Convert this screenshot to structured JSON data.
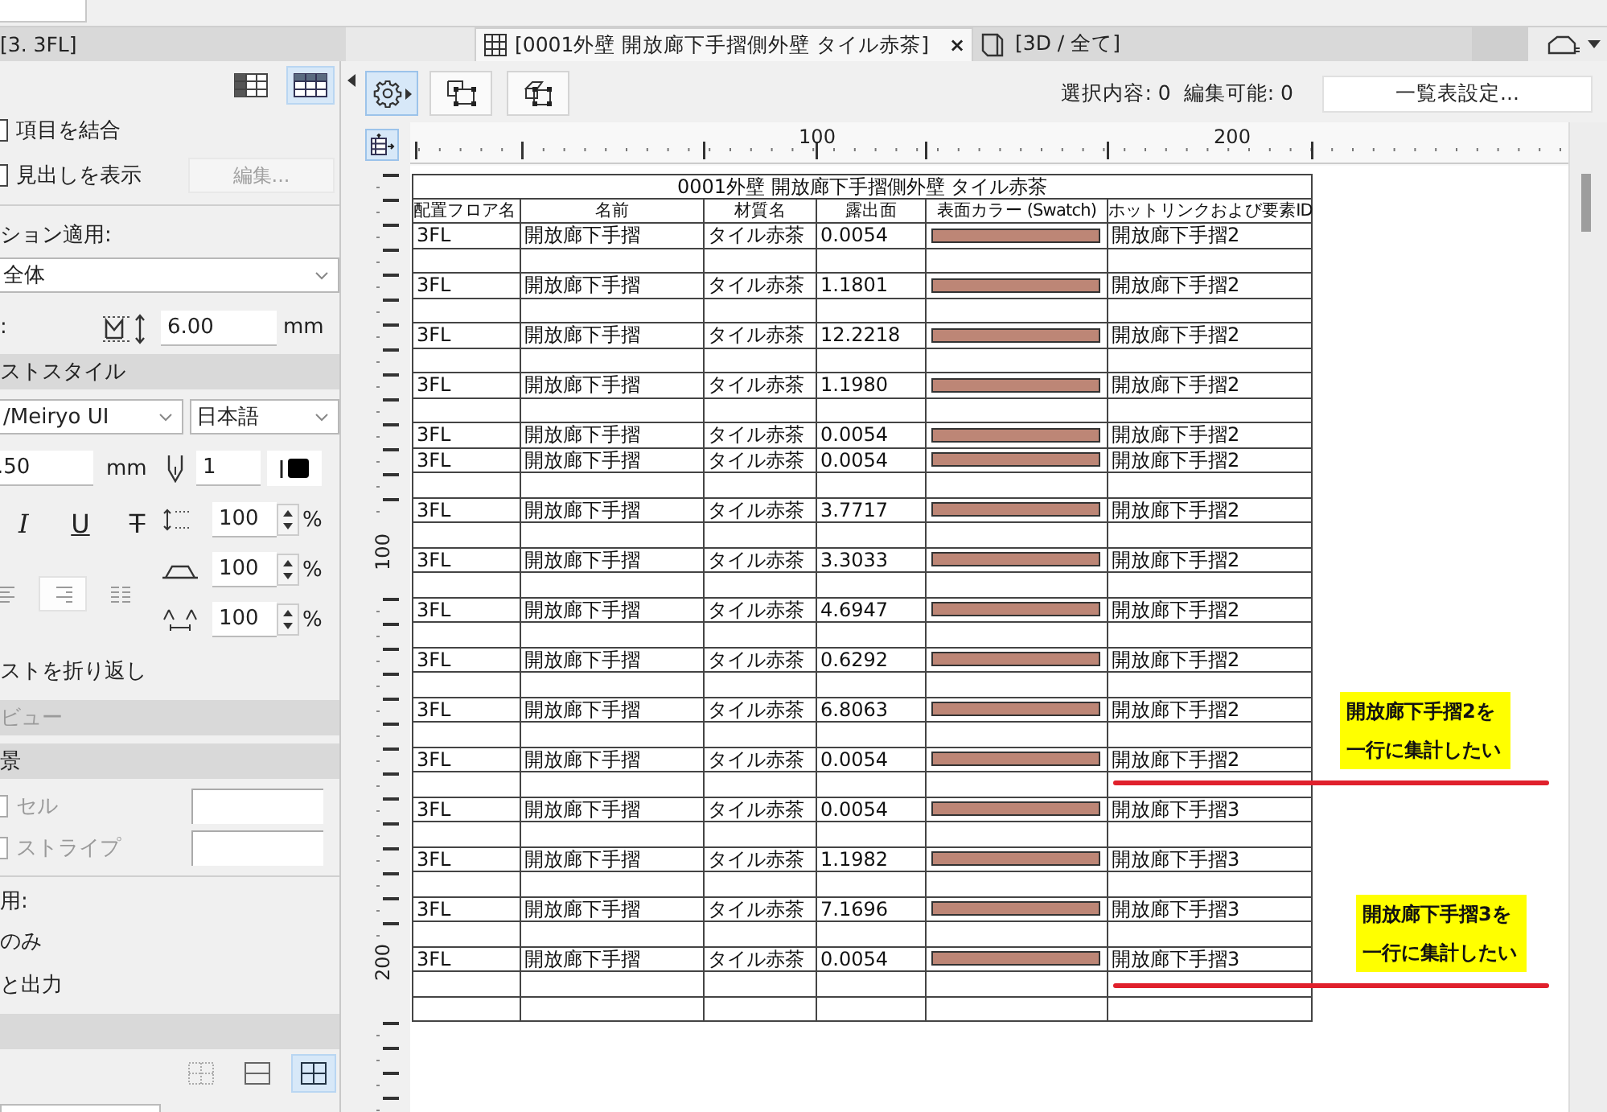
{
  "tabs": [
    {
      "label": "[3. 3FL]",
      "kind": "cut",
      "selected": false
    },
    {
      "label": "[0001外壁 開放廊下手摺側外壁  タイル赤茶]",
      "kind": "schedule",
      "selected": true,
      "close": "×"
    },
    {
      "label": "[3D / 全て]",
      "kind": "model",
      "selected": false
    }
  ],
  "side_panel": {
    "view_buttons": [
      {
        "selected": false
      },
      {
        "selected": true
      }
    ],
    "checks": [
      {
        "label": "項目を結合",
        "checked": false
      },
      {
        "label": "見出しを表示",
        "checked": false
      }
    ],
    "edit_button": {
      "label": "編集...",
      "disabled": true
    },
    "apply_label": "ション適用:",
    "apply_value": "全体",
    "height_label": ":",
    "height_value": "6.00",
    "height_unit": "mm",
    "text_style_header": "ストスタイル",
    "font": "/Meiryo UI",
    "language": "日本語",
    "size_value": ".50",
    "size_unit": "mm",
    "pen_value": "1",
    "style_buttons": [
      {
        "label": "I",
        "kind": "italic"
      },
      {
        "label": "U",
        "kind": "underline"
      },
      {
        "label": "T",
        "kind": "strike"
      }
    ],
    "align_buttons": [
      {
        "selected": false
      },
      {
        "selected": true
      },
      {
        "selected": false
      }
    ],
    "scales": [
      {
        "kind": "line",
        "value": "100",
        "unit": "%"
      },
      {
        "kind": "width",
        "value": "100",
        "unit": "%"
      },
      {
        "kind": "spacing",
        "value": "100",
        "unit": "%"
      }
    ],
    "wrap_label": "ストを折り返し",
    "preview_header": {
      "label": "ビュー",
      "disabled": true
    },
    "background_header": "景",
    "fills": [
      {
        "label": "セル",
        "checked": false,
        "disabled": true
      },
      {
        "label": "ストライプ",
        "checked": false,
        "disabled": true
      }
    ],
    "output_label": "用:",
    "output_options": [
      "のみ",
      "と出力"
    ],
    "grid_buttons": [
      {
        "selected": false
      },
      {
        "selected": false
      },
      {
        "selected": true
      }
    ]
  },
  "toolbar": {
    "status": [
      "選択内容: 0",
      "編集可能: 0"
    ],
    "settings_button": "一覧表設定..."
  },
  "rulers": {
    "horizontal": [
      "100",
      "200"
    ],
    "vertical": [
      "100",
      "200"
    ]
  },
  "schedule": {
    "title": "0001外壁 開放廊下手摺側外壁  タイル赤茶",
    "columns": [
      "配置フロア名",
      "名前",
      "材質名",
      "露出面",
      "表面カラー (Swatch)",
      "ホットリンクおよび要素ID"
    ],
    "rows": [
      {
        "kind": "data",
        "floor": "3FL",
        "name": "開放廊下手摺",
        "material": "タイル赤茶",
        "area": "0.0054",
        "color": "#bd8676",
        "hotlink": "開放廊下手摺2"
      },
      {
        "kind": "blank"
      },
      {
        "kind": "data",
        "floor": "3FL",
        "name": "開放廊下手摺",
        "material": "タイル赤茶",
        "area": "1.1801",
        "color": "#bd8676",
        "hotlink": "開放廊下手摺2"
      },
      {
        "kind": "blank"
      },
      {
        "kind": "data",
        "floor": "3FL",
        "name": "開放廊下手摺",
        "material": "タイル赤茶",
        "area": "12.2218",
        "color": "#bd8676",
        "hotlink": "開放廊下手摺2"
      },
      {
        "kind": "blank"
      },
      {
        "kind": "data",
        "floor": "3FL",
        "name": "開放廊下手摺",
        "material": "タイル赤茶",
        "area": "1.1980",
        "color": "#bd8676",
        "hotlink": "開放廊下手摺2"
      },
      {
        "kind": "blank"
      },
      {
        "kind": "data",
        "floor": "3FL",
        "name": "開放廊下手摺",
        "material": "タイル赤茶",
        "area": "0.0054",
        "color": "#bd8676",
        "hotlink": "開放廊下手摺2"
      },
      {
        "kind": "data",
        "floor": "3FL",
        "name": "開放廊下手摺",
        "material": "タイル赤茶",
        "area": "0.0054",
        "color": "#bd8676",
        "hotlink": "開放廊下手摺2"
      },
      {
        "kind": "blank"
      },
      {
        "kind": "data",
        "floor": "3FL",
        "name": "開放廊下手摺",
        "material": "タイル赤茶",
        "area": "3.7717",
        "color": "#bd8676",
        "hotlink": "開放廊下手摺2"
      },
      {
        "kind": "blank"
      },
      {
        "kind": "data",
        "floor": "3FL",
        "name": "開放廊下手摺",
        "material": "タイル赤茶",
        "area": "3.3033",
        "color": "#bd8676",
        "hotlink": "開放廊下手摺2"
      },
      {
        "kind": "blank"
      },
      {
        "kind": "data",
        "floor": "3FL",
        "name": "開放廊下手摺",
        "material": "タイル赤茶",
        "area": "4.6947",
        "color": "#bd8676",
        "hotlink": "開放廊下手摺2"
      },
      {
        "kind": "blank"
      },
      {
        "kind": "data",
        "floor": "3FL",
        "name": "開放廊下手摺",
        "material": "タイル赤茶",
        "area": "0.6292",
        "color": "#bd8676",
        "hotlink": "開放廊下手摺2"
      },
      {
        "kind": "blank"
      },
      {
        "kind": "data",
        "floor": "3FL",
        "name": "開放廊下手摺",
        "material": "タイル赤茶",
        "area": "6.8063",
        "color": "#bd8676",
        "hotlink": "開放廊下手摺2"
      },
      {
        "kind": "blank"
      },
      {
        "kind": "data",
        "floor": "3FL",
        "name": "開放廊下手摺",
        "material": "タイル赤茶",
        "area": "0.0054",
        "color": "#bd8676",
        "hotlink": "開放廊下手摺2"
      },
      {
        "kind": "blank"
      },
      {
        "kind": "data",
        "floor": "3FL",
        "name": "開放廊下手摺",
        "material": "タイル赤茶",
        "area": "0.0054",
        "color": "#bd8676",
        "hotlink": "開放廊下手摺3"
      },
      {
        "kind": "blank"
      },
      {
        "kind": "data",
        "floor": "3FL",
        "name": "開放廊下手摺",
        "material": "タイル赤茶",
        "area": "1.1982",
        "color": "#bd8676",
        "hotlink": "開放廊下手摺3"
      },
      {
        "kind": "blank"
      },
      {
        "kind": "data",
        "floor": "3FL",
        "name": "開放廊下手摺",
        "material": "タイル赤茶",
        "area": "7.1696",
        "color": "#bd8676",
        "hotlink": "開放廊下手摺3"
      },
      {
        "kind": "blank"
      },
      {
        "kind": "data",
        "floor": "3FL",
        "name": "開放廊下手摺",
        "material": "タイル赤茶",
        "area": "0.0054",
        "color": "#bd8676",
        "hotlink": "開放廊下手摺3"
      },
      {
        "kind": "blank"
      },
      {
        "kind": "blank"
      }
    ]
  },
  "notes": [
    {
      "lines": [
        "開放廊下手摺2を",
        "一行に集計したい"
      ]
    },
    {
      "lines": [
        "開放廊下手摺3を",
        "一行に集計したい"
      ]
    }
  ]
}
